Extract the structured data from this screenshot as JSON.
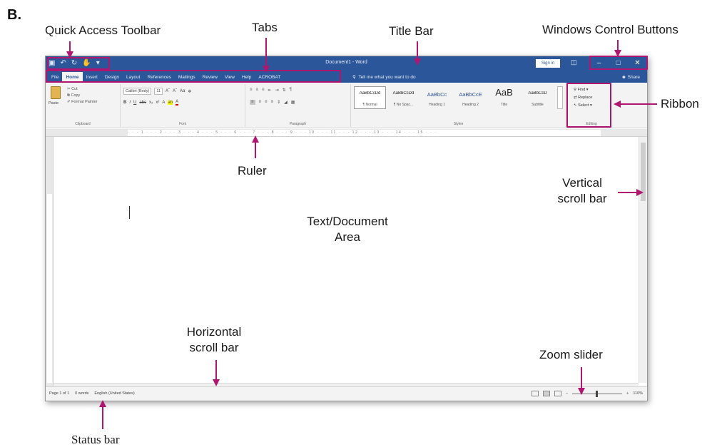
{
  "figure_label": "B.",
  "callouts": {
    "quick_access_toolbar": "Quick Access Toolbar",
    "tabs": "Tabs",
    "title_bar": "Title Bar",
    "window_controls": "Windows Control Buttons",
    "ribbon": "Ribbon",
    "ruler": "Ruler",
    "vertical_scroll_1": "Vertical",
    "vertical_scroll_2": "scroll bar",
    "text_area_1": "Text/Document",
    "text_area_2": "Area",
    "horizontal_scroll_1": "Horizontal",
    "horizontal_scroll_2": "scroll bar",
    "zoom_slider": "Zoom slider",
    "status_bar": "Status bar"
  },
  "window": {
    "title": "Document1 - Word",
    "sign_in": "Sign in",
    "qat_icons": [
      "save-icon",
      "undo-icon",
      "redo-icon",
      "touch-mode-icon",
      "customize-icon"
    ],
    "tabs": [
      "File",
      "Home",
      "Insert",
      "Design",
      "Layout",
      "References",
      "Mailings",
      "Review",
      "View",
      "Help",
      "ACROBAT"
    ],
    "active_tab": "Home",
    "tell_me": "Tell me what you want to do",
    "share": "Share"
  },
  "ribbon": {
    "clipboard": {
      "label": "Clipboard",
      "paste": "Paste",
      "cut": "Cut",
      "copy": "Copy",
      "format_painter": "Format Painter"
    },
    "font": {
      "label": "Font",
      "font_name": "Calibri (Body)",
      "font_size": "11"
    },
    "paragraph": {
      "label": "Paragraph"
    },
    "styles": {
      "label": "Styles",
      "items": [
        {
          "sample": "AaBbCcDd",
          "name": "¶ Normal"
        },
        {
          "sample": "AaBbCcDd",
          "name": "¶ No Spac..."
        },
        {
          "sample": "AaBbCc",
          "name": "Heading 1"
        },
        {
          "sample": "AaBbCcE",
          "name": "Heading 2"
        },
        {
          "sample": "AaB",
          "name": "Title"
        },
        {
          "sample": "AaBbCcD",
          "name": "Subtitle"
        }
      ]
    },
    "editing": {
      "label": "Editing",
      "find": "Find",
      "replace": "Replace",
      "select": "Select"
    }
  },
  "status": {
    "page": "Page 1 of 1",
    "words": "0 words",
    "language": "English (United States)",
    "zoom": "110%"
  },
  "colors": {
    "title_bar": "#2b579a",
    "annotation": "#b0166f"
  }
}
